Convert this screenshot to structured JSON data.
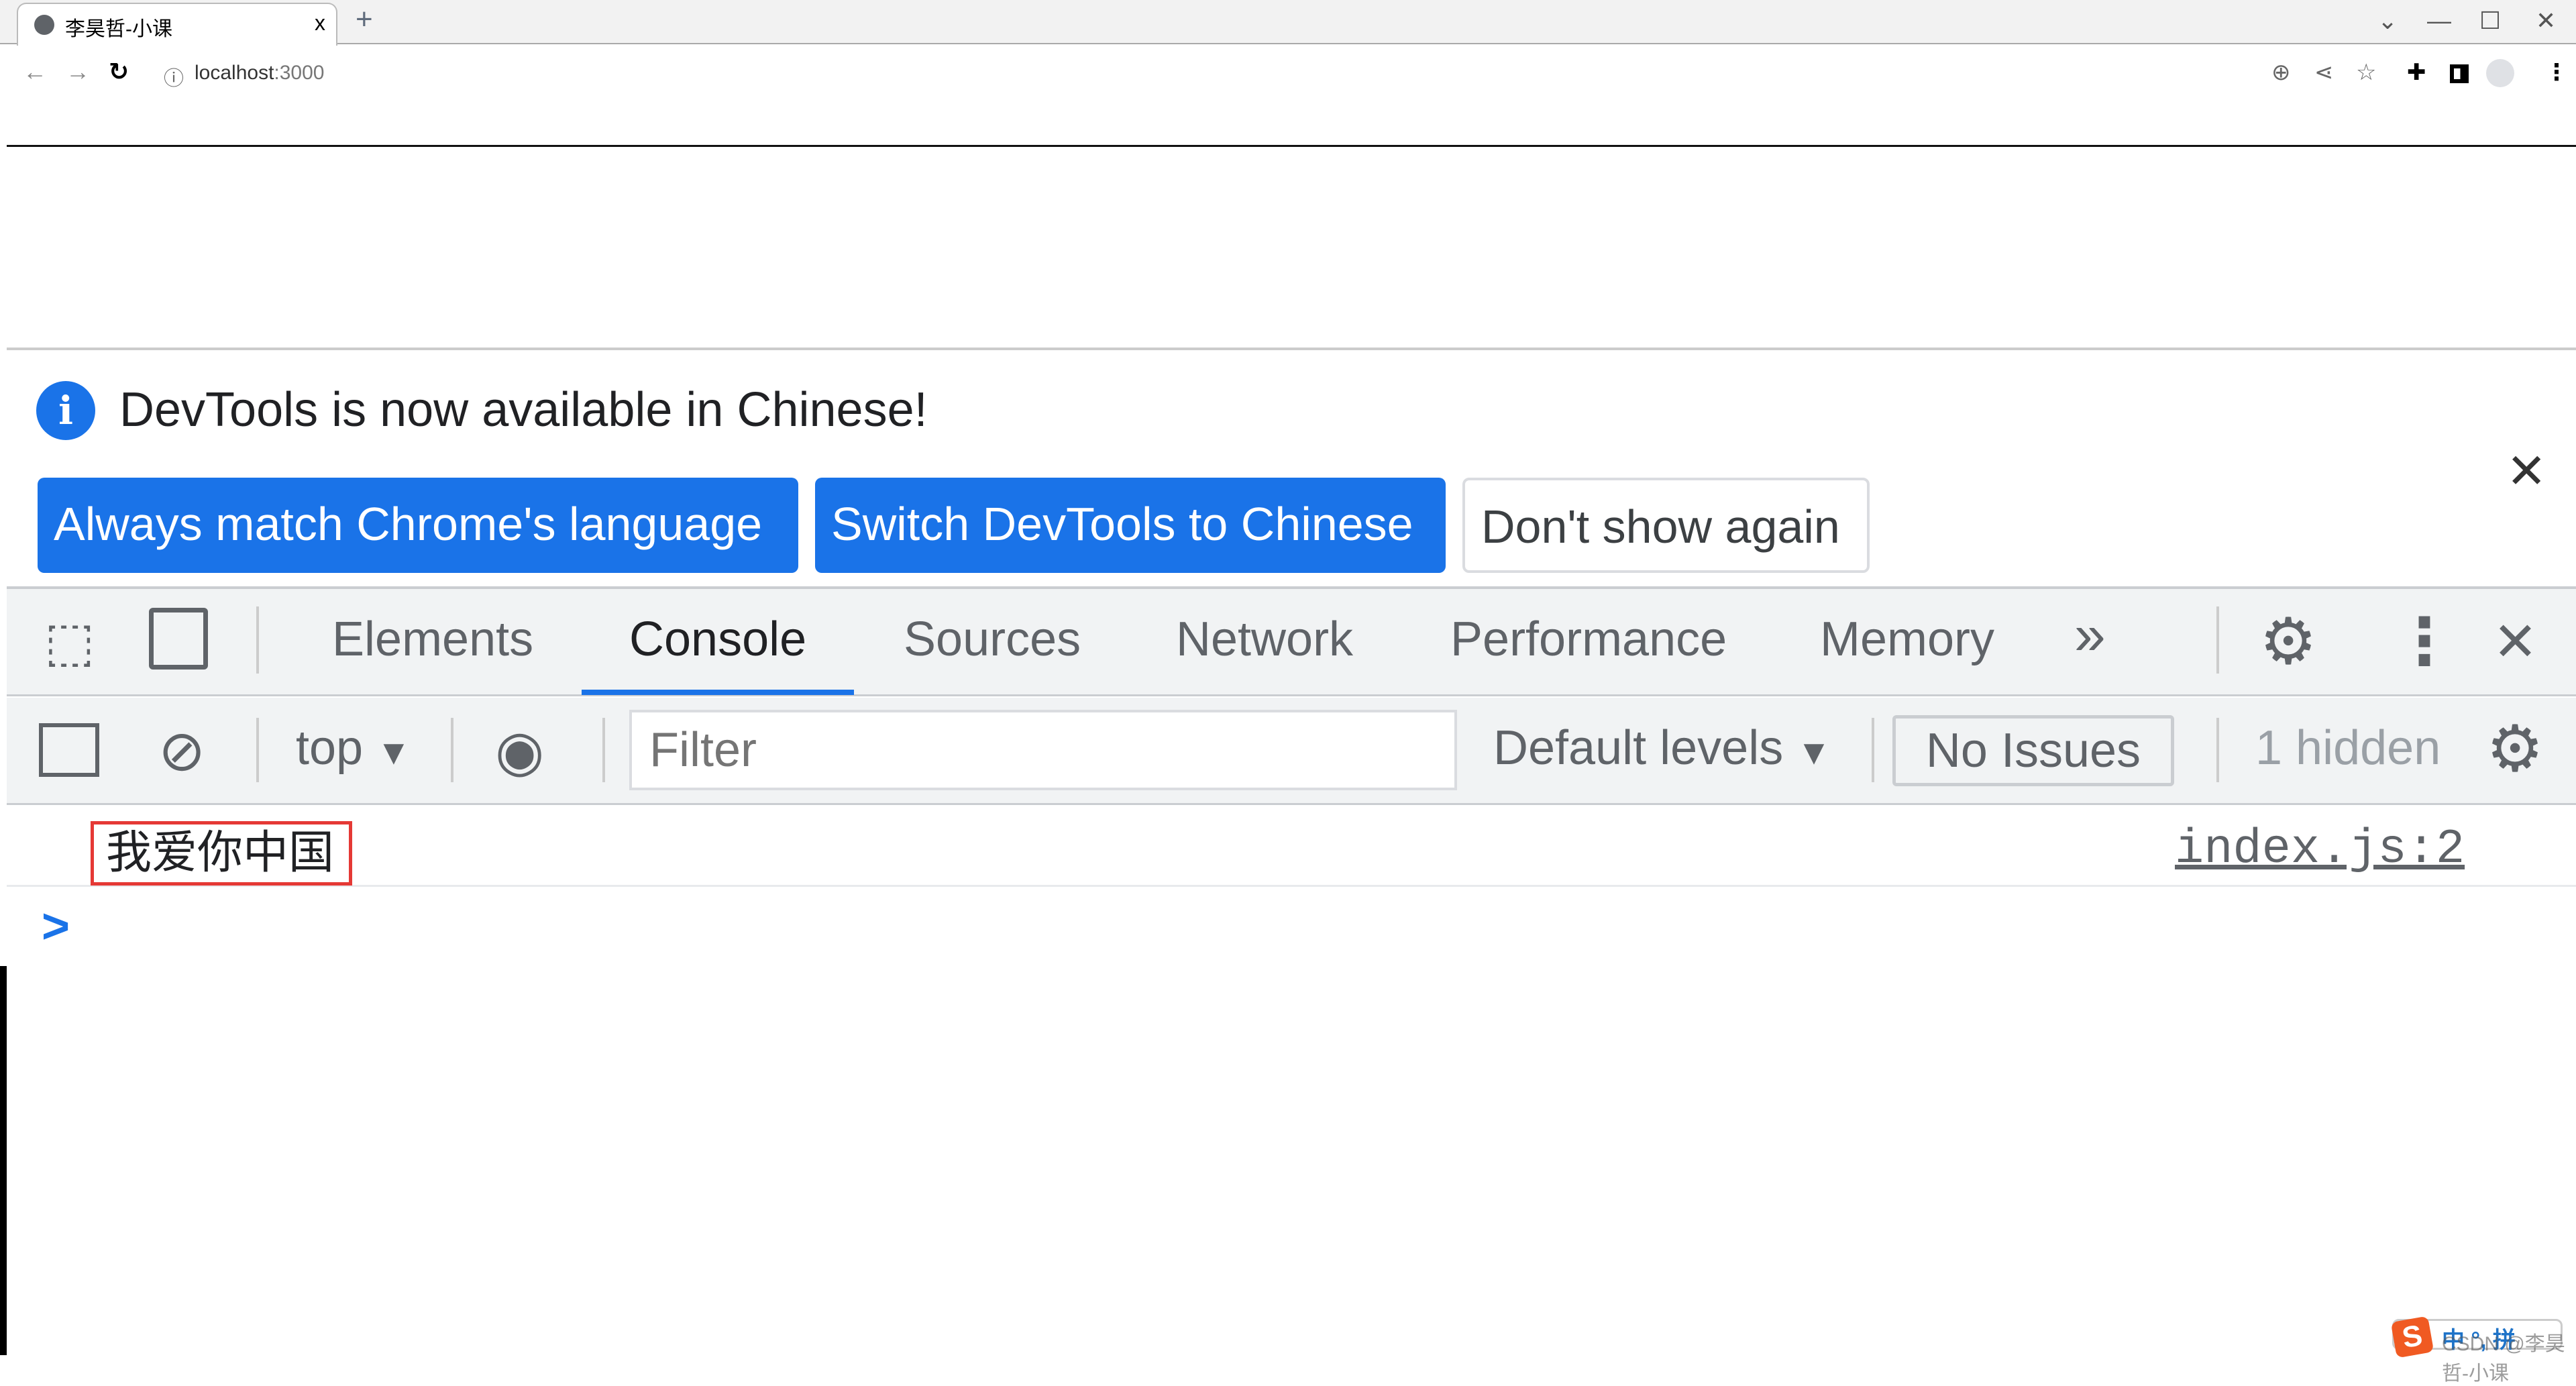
{
  "browser": {
    "tab_title": "李昊哲-小课",
    "new_tab": "+",
    "tab_close": "x",
    "url_host": "localhost",
    "url_port": ":3000"
  },
  "infobar": {
    "message": "DevTools is now available in Chinese!",
    "buttons": [
      "Always match Chrome's language",
      "Switch DevTools to Chinese",
      "Don't show again"
    ]
  },
  "devtools": {
    "tabs": [
      "Elements",
      "Console",
      "Sources",
      "Network",
      "Performance",
      "Memory"
    ],
    "active_tab": "Console",
    "more": "»"
  },
  "console_toolbar": {
    "context": "top",
    "filter_placeholder": "Filter",
    "levels": "Default levels",
    "issues": "No Issues",
    "hidden": "1 hidden"
  },
  "console": {
    "messages": [
      {
        "text": "我爱你中国",
        "source": "index.js:2"
      }
    ],
    "prompt": ">"
  },
  "ime": {
    "label": "中 °, 拼",
    "watermark": "CSDN @李昊哲-小课"
  },
  "colors": {
    "accent": "#1a73e8",
    "highlight_box": "#e53935"
  }
}
